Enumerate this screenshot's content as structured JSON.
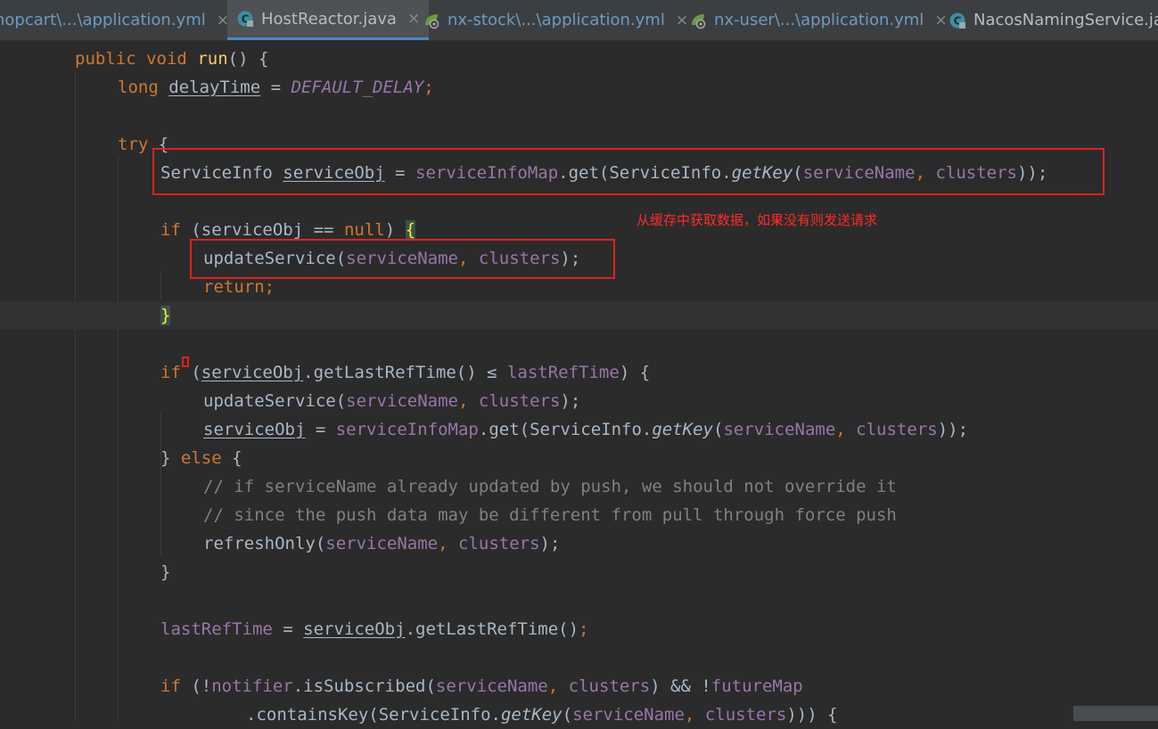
{
  "tabs": [
    {
      "label": "hopcart\\...\\application.yml",
      "icon": "spring-yml-icon",
      "type": "yml",
      "active": false
    },
    {
      "label": "HostReactor.java",
      "icon": "java-class-icon",
      "type": "java",
      "active": true
    },
    {
      "label": "nx-stock\\...\\application.yml",
      "icon": "spring-yml-icon",
      "type": "yml",
      "active": false
    },
    {
      "label": "nx-user\\...\\application.yml",
      "icon": "spring-yml-icon",
      "type": "yml",
      "active": false
    },
    {
      "label": "NacosNamingService.java",
      "icon": "java-class-icon",
      "type": "java",
      "active": false
    }
  ],
  "close_glyph": "×",
  "annotation": "从缓存中获取数据，如果没有则发送请求",
  "code": {
    "l1": {
      "kw1": "public",
      "kw2": "void",
      "fn": "run",
      "rest": "() {"
    },
    "l2": {
      "type": "long",
      "var": "delayTime",
      "eq": " = ",
      "const": "DEFAULT_DELAY",
      "semi": ";"
    },
    "l3": {
      "kw": "try",
      "brace": " {"
    },
    "l4": {
      "type": "ServiceInfo",
      "var": "serviceObj",
      "eq": " = ",
      "map": "serviceInfoMap",
      "call": ".get(ServiceInfo.",
      "getkey": "getKey",
      "p1": "(",
      "a1": "serviceName",
      "comma": ", ",
      "a2": "clusters",
      "close": "));"
    },
    "l5": {
      "kw": "if",
      "open": " (serviceObj ",
      "op": "==",
      "sp": " ",
      "null": "null",
      "close": ") ",
      "brace": "{"
    },
    "l6": {
      "fn": "updateService(",
      "a1": "serviceName",
      "comma": ", ",
      "a2": "clusters",
      "close": ");"
    },
    "l7": {
      "kw": "return",
      "semi": ";"
    },
    "l8": {
      "brace": "}"
    },
    "l9": {
      "kw": "if",
      "open": " (",
      "var": "serviceObj",
      "call": ".getLastRefTime() ",
      "op": "≤",
      "sp": " ",
      "field": "lastRefTime",
      "close": ") {"
    },
    "l10": {
      "fn": "updateService(",
      "a1": "serviceName",
      "comma": ", ",
      "a2": "clusters",
      "close": ");"
    },
    "l11": {
      "var": "serviceObj",
      "eq": " = ",
      "map": "serviceInfoMap",
      "call": ".get(ServiceInfo.",
      "getkey": "getKey",
      "p1": "(",
      "a1": "serviceName",
      "comma": ", ",
      "a2": "clusters",
      "close": "));"
    },
    "l12": {
      "brace": "} ",
      "kw": "else",
      "rest": " {"
    },
    "l13": "// if serviceName already updated by push, we should not override it",
    "l14": "// since the push data may be different from pull through force push",
    "l15": {
      "fn": "refreshOnly(",
      "a1": "serviceName",
      "comma": ", ",
      "a2": "clusters",
      "close": ");"
    },
    "l16": "}",
    "l17": {
      "field": "lastRefTime",
      "eq": " = ",
      "var": "serviceObj",
      "call": ".getLastRefTime()",
      "semi": ";"
    },
    "l18": {
      "kw": "if",
      "open": " (!",
      "field1": "notifier",
      "call": ".isSubscribed(",
      "a1": "serviceName",
      "comma": ", ",
      "a2": "clusters",
      "mid": ") && !",
      "field2": "futureMap"
    },
    "l19": {
      "call": ".containsKey(ServiceInfo.",
      "getkey": "getKey",
      "p1": "(",
      "a1": "serviceName",
      "comma": ", ",
      "a2": "clusters",
      "close": "))) {"
    }
  }
}
